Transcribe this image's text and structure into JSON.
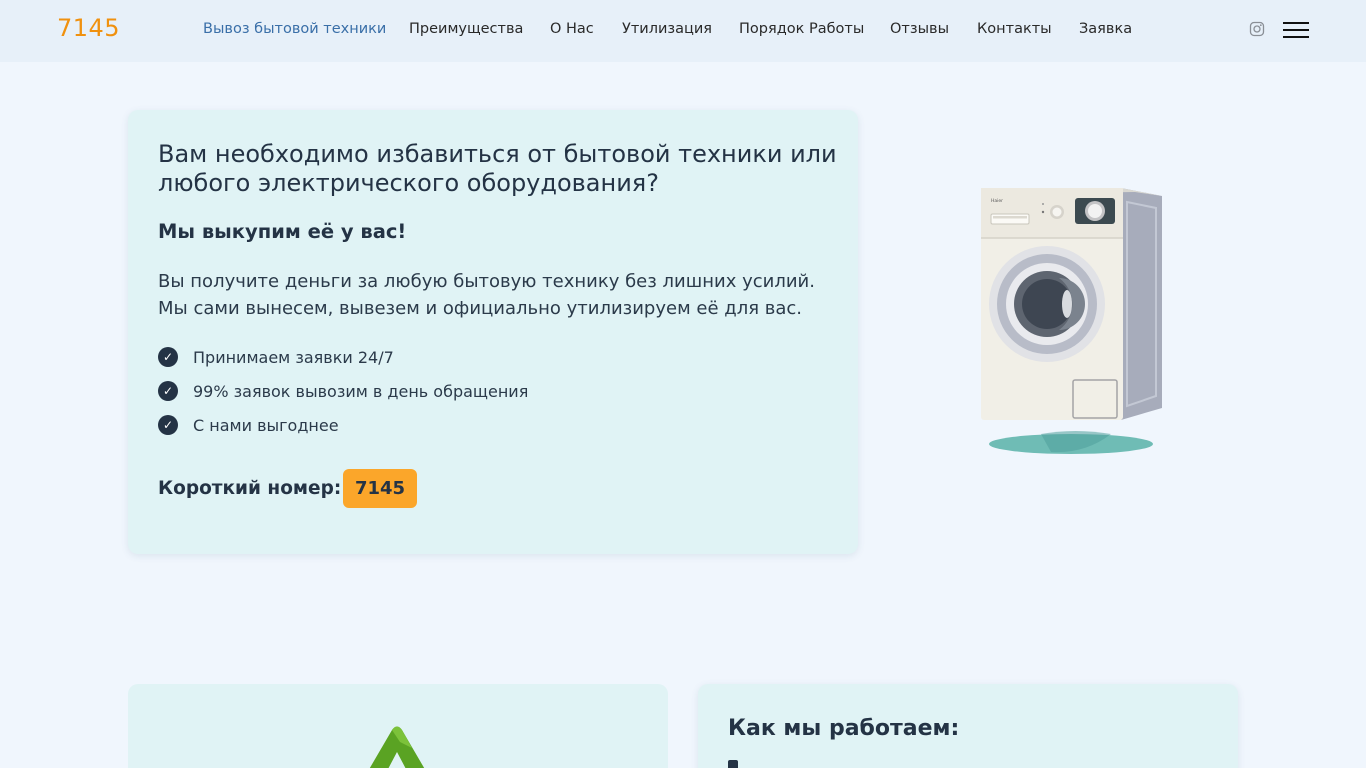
{
  "header": {
    "logo": "7145",
    "nav": [
      {
        "label": "Вывоз бытовой техники",
        "active": true
      },
      {
        "label": "Преимущества",
        "active": false
      },
      {
        "label": "О Нас",
        "active": false
      },
      {
        "label": "Утилизация",
        "active": false
      },
      {
        "label": "Порядок Работы",
        "active": false
      },
      {
        "label": "Отзывы",
        "active": false
      },
      {
        "label": "Контакты",
        "active": false
      },
      {
        "label": "Заявка",
        "active": false
      }
    ],
    "icons": [
      "instagram-icon",
      "menu-icon"
    ]
  },
  "hero": {
    "title": "Вам необходимо избавиться от бытовой техники или любого электрического оборудования?",
    "subtitle": "Мы выкупим её у вас!",
    "description": "Вы получите деньги за любую бытовую технику без лишних усилий. Мы сами вынесем, вывезем и официально утилизируем её для вас.",
    "features": [
      "Принимаем заявки 24/7",
      "99% заявок вывозим в день обращения",
      "С нами выгоднее"
    ],
    "short_number_label": "Короткий номер:",
    "short_number": "7145",
    "illustration": "washing-machine-illustration"
  },
  "how_we_work": {
    "title": "Как мы работаем:"
  },
  "colors": {
    "accent": "#f0910f",
    "badge": "#fba62a",
    "card_bg": "#e0f3f5",
    "page_bg": "#f0f6fd",
    "nav_active": "#3a6fa8",
    "text": "#243345"
  }
}
